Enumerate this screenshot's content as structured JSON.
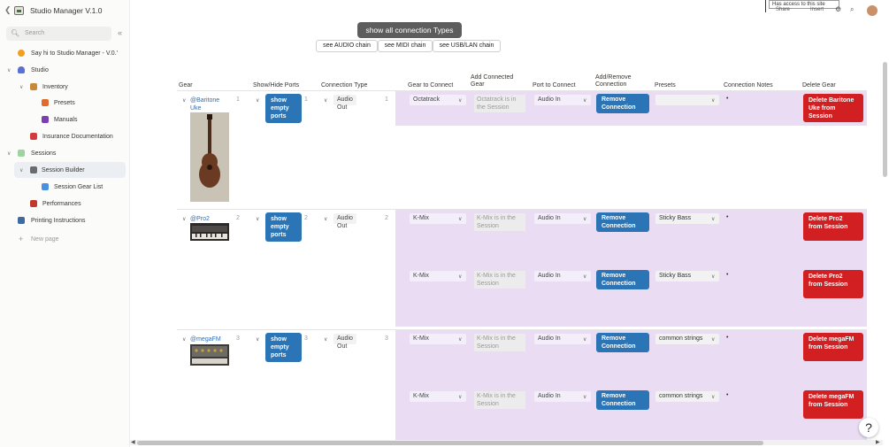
{
  "app": {
    "title": "Studio Manager V.1.0"
  },
  "search": {
    "placeholder": "Search"
  },
  "sidebar": {
    "items": [
      {
        "label": "Say hi to Studio Manager - V.0.'"
      },
      {
        "label": "Studio"
      },
      {
        "label": "Inventory"
      },
      {
        "label": "Presets"
      },
      {
        "label": "Manuals"
      },
      {
        "label": "Insurance Documentation"
      },
      {
        "label": "Sessions"
      },
      {
        "label": "Session Builder"
      },
      {
        "label": "Session Gear List"
      },
      {
        "label": "Performances"
      },
      {
        "label": "Printing Instructions"
      },
      {
        "label": "New page"
      }
    ]
  },
  "topbar": {
    "tooltip": "Has access to this site",
    "share": "Share",
    "insert": "Insert"
  },
  "controls": {
    "show_all": "show all connection Types",
    "chains": [
      "see AUDIO chain",
      "see MIDI chain",
      "see USB/LAN chain"
    ]
  },
  "table": {
    "headers": [
      "Gear",
      "Show/Hide Ports",
      "Connection Type",
      "Gear to Connect",
      "Add Connected Gear",
      "Port to Connect",
      "Add/Remove Connection",
      "Presets",
      "Connection Notes",
      "Delete Gear"
    ]
  },
  "rows": [
    {
      "gear": "@Baritone Uke",
      "gear_num": "1",
      "show_label": "show empty ports",
      "port_num": "1",
      "conn_type": "Audio Out",
      "conn_num": "1",
      "subrows": [
        {
          "gear_to_connect": "Octatrack",
          "connected_text": "Octatrack is in the Session",
          "port": "Audio In",
          "remove": "Remove Connection",
          "preset": "",
          "note": "•"
        }
      ],
      "delete": "Delete Baritone Uke from Session"
    },
    {
      "gear": "@Pro2",
      "gear_num": "2",
      "show_label": "show empty ports",
      "port_num": "2",
      "conn_type": "Audio Out",
      "conn_num": "2",
      "subrows": [
        {
          "gear_to_connect": "K-Mix",
          "connected_text": "K-Mix is in the Session",
          "port": "Audio In",
          "remove": "Remove Connection",
          "preset": "Sticky Bass",
          "note": "•"
        },
        {
          "gear_to_connect": "K-Mix",
          "connected_text": "K-Mix is in the Session",
          "port": "Audio In",
          "remove": "Remove Connection",
          "preset": "Sticky Bass",
          "note": "•"
        }
      ],
      "delete": "Delete Pro2 from Session"
    },
    {
      "gear": "@megaFM",
      "gear_num": "3",
      "show_label": "show empty ports",
      "port_num": "3",
      "conn_type": "Audio Out",
      "conn_num": "3",
      "subrows": [
        {
          "gear_to_connect": "K-Mix",
          "connected_text": "K-Mix is in the Session",
          "port": "Audio In",
          "remove": "Remove Connection",
          "preset": "common strings",
          "note": "•"
        },
        {
          "gear_to_connect": "K-Mix",
          "connected_text": "K-Mix is in the Session",
          "port": "Audio In",
          "remove": "Remove Connection",
          "preset": "common strings",
          "note": "•"
        }
      ],
      "delete": "Delete megaFM from Session"
    }
  ],
  "help": {
    "label": "?"
  },
  "colors": {
    "blue": "#2b74b6",
    "red": "#d21f22",
    "purple": "#e9dcf3"
  }
}
